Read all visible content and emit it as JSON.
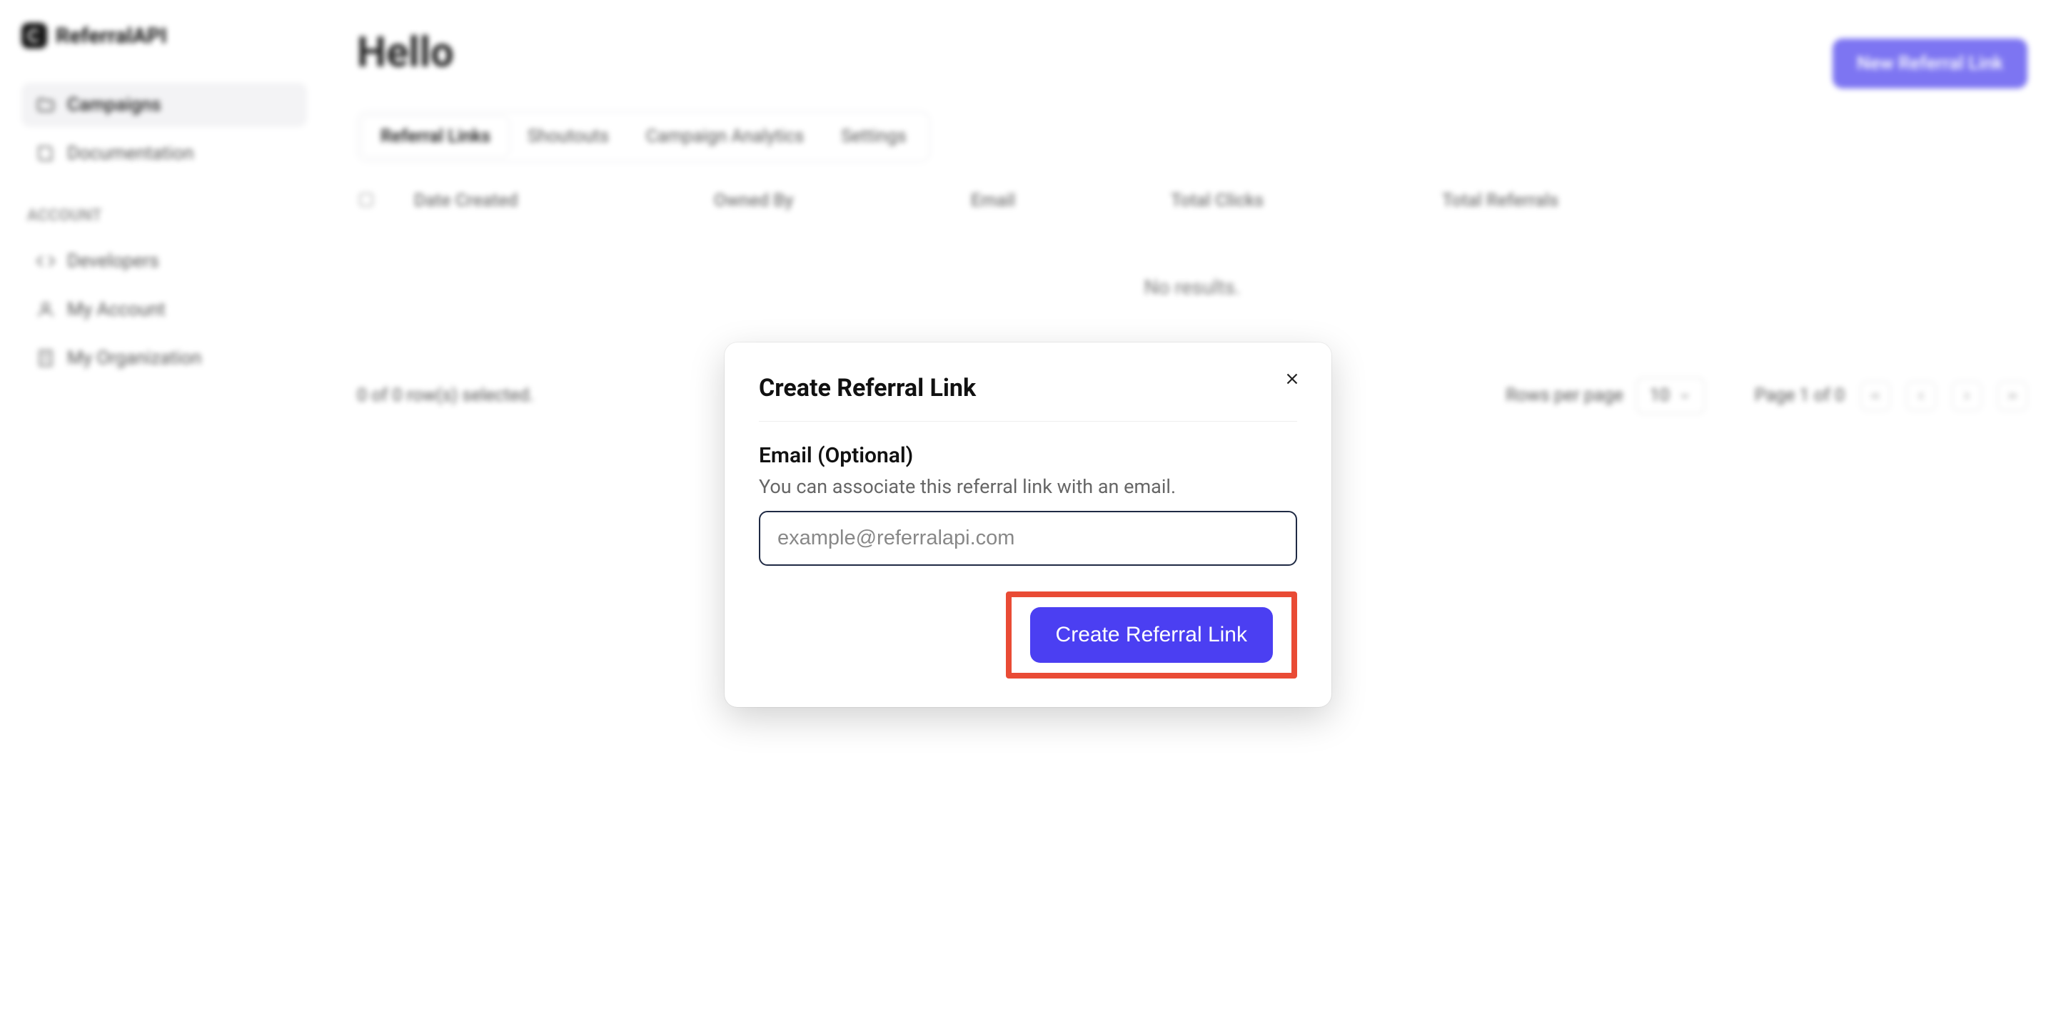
{
  "brand": {
    "name": "ReferralAPI"
  },
  "sidebar": {
    "items": [
      {
        "label": "Campaigns",
        "icon": "folder"
      },
      {
        "label": "Documentation",
        "icon": "book"
      }
    ],
    "section_title": "ACCOUNT",
    "account_items": [
      {
        "label": "Developers",
        "icon": "code"
      },
      {
        "label": "My Account",
        "icon": "user"
      },
      {
        "label": "My Organization",
        "icon": "building"
      }
    ]
  },
  "header": {
    "title": "Hello",
    "new_link_label": "New Referral Link"
  },
  "tabs": [
    {
      "label": "Referral Links",
      "active": true
    },
    {
      "label": "Shoutouts"
    },
    {
      "label": "Campaign Analytics"
    },
    {
      "label": "Settings"
    }
  ],
  "table": {
    "columns": [
      "Date Created",
      "Owned By",
      "Email",
      "Total Clicks",
      "Total Referrals"
    ],
    "no_results": "No results.",
    "rows_selected": "0 of 0 row(s) selected.",
    "rows_per_page_label": "Rows per page",
    "rows_per_page_value": "10",
    "page_info": "Page 1 of 0"
  },
  "modal": {
    "title": "Create Referral Link",
    "email_label": "Email (Optional)",
    "email_hint": "You can associate this referral link with an email.",
    "email_placeholder": "example@referralapi.com",
    "submit_label": "Create Referral Link"
  },
  "colors": {
    "primary": "#4b3ff2",
    "highlight": "#e94b35"
  }
}
